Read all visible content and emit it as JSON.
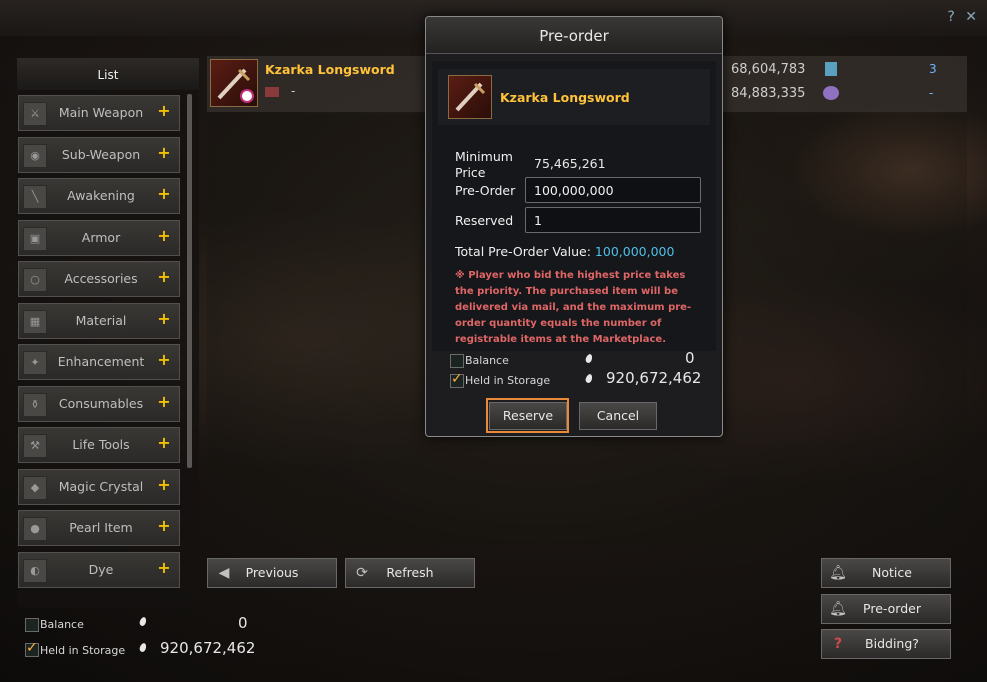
{
  "top_icons": {
    "help": "?",
    "close": "✕"
  },
  "list": {
    "title": "List",
    "categories": [
      {
        "label": "Main Weapon",
        "icon": "sword-icon"
      },
      {
        "label": "Sub-Weapon",
        "icon": "shield-icon"
      },
      {
        "label": "Awakening",
        "icon": "awakening-weapon-icon"
      },
      {
        "label": "Armor",
        "icon": "armor-icon"
      },
      {
        "label": "Accessories",
        "icon": "ring-icon"
      },
      {
        "label": "Material",
        "icon": "material-icon"
      },
      {
        "label": "Enhancement",
        "icon": "enhancement-icon"
      },
      {
        "label": "Consumables",
        "icon": "potion-icon"
      },
      {
        "label": "Life Tools",
        "icon": "tools-icon"
      },
      {
        "label": "Magic Crystal",
        "icon": "crystal-icon"
      },
      {
        "label": "Pearl Item",
        "icon": "pearl-icon"
      },
      {
        "label": "Dye",
        "icon": "palette-icon"
      }
    ],
    "plus": "+"
  },
  "item": {
    "name": "Kzarka Longsword",
    "sub": "-",
    "price1": "68,604,783",
    "price2": "84,883,335",
    "count1": "3",
    "count2": "-"
  },
  "buttons": {
    "previous": "Previous",
    "refresh": "Refresh",
    "notice": "Notice",
    "preorder": "Pre-order",
    "bidding": "Bidding?"
  },
  "wallet": {
    "balance_label": "Balance",
    "balance_value": "0",
    "storage_label": "Held in Storage",
    "storage_value": "920,672,462"
  },
  "modal": {
    "title": "Pre-order",
    "item_name": "Kzarka Longsword",
    "min_price_label_1": "Minimum",
    "min_price_label_2": "Price",
    "min_price_value": "75,465,261",
    "preorder_label": "Pre-Order",
    "preorder_value": "100,000,000",
    "reserved_label": "Reserved",
    "reserved_value": "1",
    "total_label": "Total Pre-Order Value:",
    "total_value": "100,000,000",
    "warning": "※ Player who bid the highest price takes the priority. The purchased item will be delivered via mail, and the maximum pre-order quantity equals the number of registrable items at the Marketplace.",
    "balance_label": "Balance",
    "balance_value": "0",
    "storage_label": "Held in Storage",
    "storage_value": "920,672,462",
    "reserve": "Reserve",
    "cancel": "Cancel"
  },
  "colors": {
    "accent": "#ffc23a",
    "highlight": "#e88a3a",
    "value_blue": "#4fbfe8",
    "warning": "#e06666"
  }
}
